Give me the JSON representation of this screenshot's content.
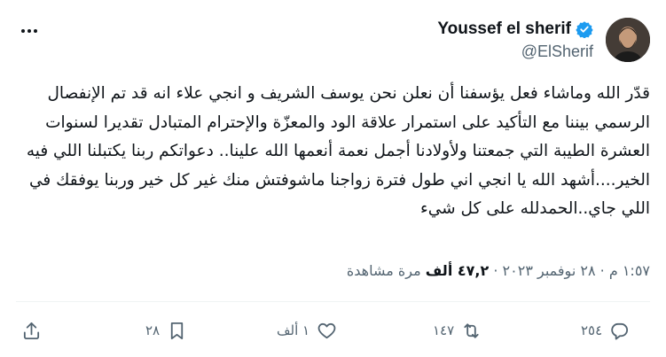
{
  "author": {
    "display_name": "Youssef el sherif",
    "handle": "@ElSherif",
    "verified": true,
    "verified_color": "#1d9bf0"
  },
  "tweet": {
    "text": "قدّر الله وماشاء فعل يؤسفنا أن نعلن نحن يوسف الشريف و انجي علاء انه قد تم الإنفصال الرسمي بيننا مع التأكيد على استمرار علاقة الود والمعزّة والإحترام المتبادل تقديرا لسنوات العشرة الطيبة التي جمعتنا ولأولادنا أجمل نعمة أنعمها الله علينا.. دعواتكم ربنا يكتبلنا اللي فيه الخير....أشهد الله يا انجي اني طول فترة زواجنا ماشوفتش منك غير كل خير وربنا يوفقك في اللي جاي..الحمدلله على كل شيء"
  },
  "meta": {
    "time": "١:٥٧ م",
    "date": "٢٨ نوفمبر ٢٠٢٣",
    "separator": "·",
    "views_count": "٤٧,٢ ألف",
    "views_label": "مرة مشاهدة"
  },
  "actions": {
    "reply_count": "٢٥٤",
    "retweet_count": "١٤٧",
    "like_count": "١ ألف",
    "bookmark_count": "٢٨",
    "icons": [
      "reply-icon",
      "retweet-icon",
      "like-icon",
      "bookmark-icon",
      "share-icon"
    ]
  },
  "colors": {
    "text": "#0f1419",
    "secondary": "#536471",
    "divider": "#eff3f4"
  }
}
